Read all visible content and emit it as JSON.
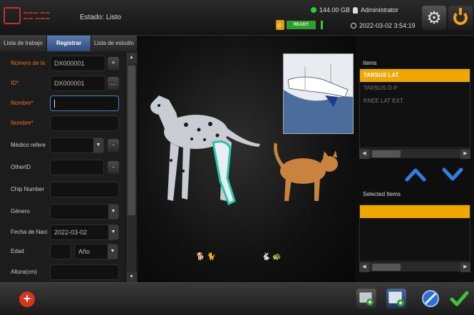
{
  "header": {
    "status_label": "Estado: Listo",
    "disk_space": "144.00 GB",
    "user": "Administrator",
    "ready_label": "READY",
    "datetime": "2022-03-02 3:54:19",
    "settings_icon": "gear-icon",
    "power_icon": "power-icon"
  },
  "tabs": [
    {
      "label": "Lista de trabajo"
    },
    {
      "label": "Registrar"
    },
    {
      "label": "Lista de estudio"
    }
  ],
  "form": {
    "patient_number": {
      "label": "Número de la",
      "value": "DX000001"
    },
    "id": {
      "label": "ID*",
      "value": "DX000001"
    },
    "name1": {
      "label": "Nombre*",
      "value": ""
    },
    "name2": {
      "label": "Nombre*",
      "value": ""
    },
    "referring_doctor": {
      "label": "Médico refere",
      "value": ""
    },
    "other_id": {
      "label": "OtherID",
      "value": ""
    },
    "chip_number": {
      "label": "Chip Number",
      "value": ""
    },
    "gender": {
      "label": "Género",
      "value": ""
    },
    "birth_date": {
      "label": "Fecha de Naci",
      "value": "2022-03-02"
    },
    "age": {
      "label": "Edad",
      "value": "",
      "unit": "Año"
    },
    "height": {
      "label": "Altura(cm)",
      "value": ""
    }
  },
  "right": {
    "items_title": "Items",
    "items": [
      "TARSUS LAT",
      "TARSUS D-P",
      "KNEE LAT EXT"
    ],
    "selected_title": "Selected Items",
    "selected_items": [
      ""
    ]
  },
  "colors": {
    "accent_orange": "#f0a800",
    "required_label": "#e8702a",
    "ready_green": "#2e9e2e",
    "focus_border": "#4a80c0"
  }
}
